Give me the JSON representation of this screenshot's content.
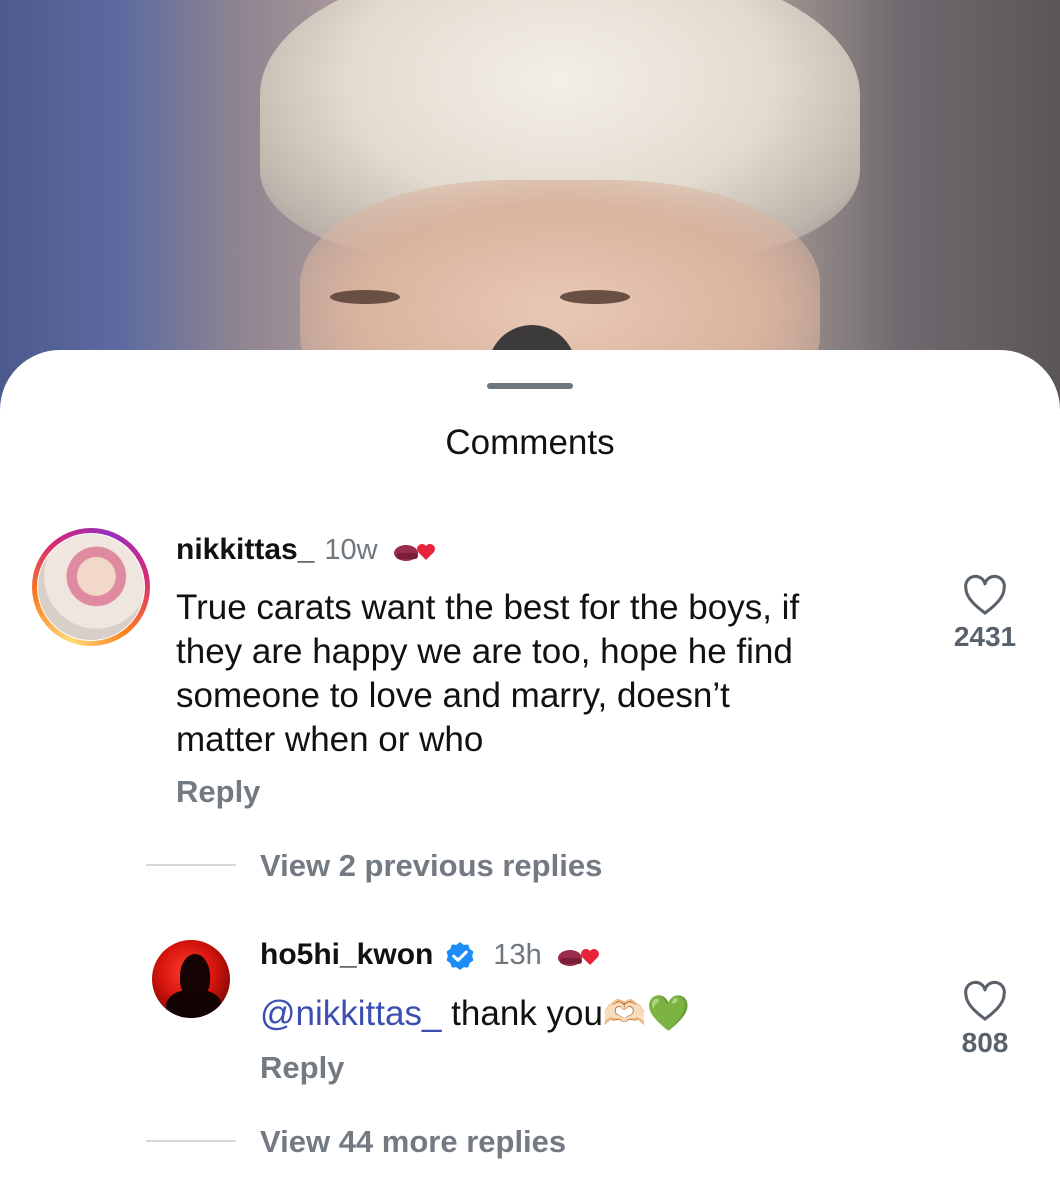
{
  "sheet": {
    "title": "Comments"
  },
  "comments": [
    {
      "username": "nikkittas_",
      "time": "10w",
      "text_lines": [
        "True carats want the best for the boys, if",
        "they are happy we are too, hope he find",
        "someone to love and marry, doesn’t",
        "matter when or who"
      ],
      "reply_label": "Reply",
      "like_count": "2431",
      "view_replies": "View 2 previous replies"
    },
    {
      "username": "ho5hi_kwon",
      "time": "13h",
      "mention": "@nikkittas_",
      "text": " thank you🫶🏻💚",
      "reply_label": "Reply",
      "like_count": "808",
      "view_replies": "View 44 more replies"
    }
  ],
  "icons": {
    "heart_outline": "heart-icon",
    "verified": "verified-badge-icon",
    "author_liked": "author-liked-badge-icon"
  },
  "colors": {
    "mention": "#3c4fb0",
    "verified": "#1d8cf8",
    "badge_heart": "#e8233a"
  }
}
